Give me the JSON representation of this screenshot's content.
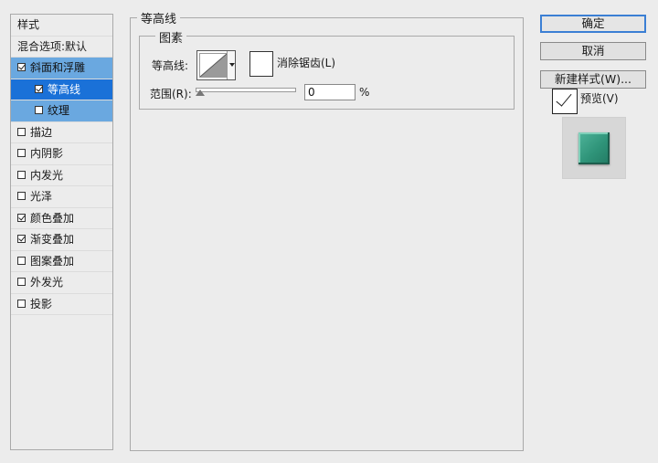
{
  "style_list": {
    "header": "样式",
    "blend_options": "混合选项:默认",
    "items": [
      {
        "label": "斜面和浮雕",
        "checked": true
      },
      {
        "label": "等高线",
        "checked": true
      },
      {
        "label": "纹理",
        "checked": false
      },
      {
        "label": "描边",
        "checked": false
      },
      {
        "label": "内阴影",
        "checked": false
      },
      {
        "label": "内发光",
        "checked": false
      },
      {
        "label": "光泽",
        "checked": false
      },
      {
        "label": "颜色叠加",
        "checked": true
      },
      {
        "label": "渐变叠加",
        "checked": true
      },
      {
        "label": "图案叠加",
        "checked": false
      },
      {
        "label": "外发光",
        "checked": false
      },
      {
        "label": "投影",
        "checked": false
      }
    ]
  },
  "panel": {
    "title": "等高线",
    "group_title": "图素",
    "contour_label": "等高线:",
    "antialias_label": "消除锯齿(L)",
    "range_label": "范围(R):",
    "range_value": "0",
    "range_unit": "%"
  },
  "buttons": {
    "ok": "确定",
    "cancel": "取消",
    "new_style": "新建样式(W)...",
    "preview_label": "预览(V)"
  },
  "colors": {
    "selected_item": "#1a71d8",
    "parent_item": "#6aa8e0",
    "swatch": "#2f9479"
  }
}
